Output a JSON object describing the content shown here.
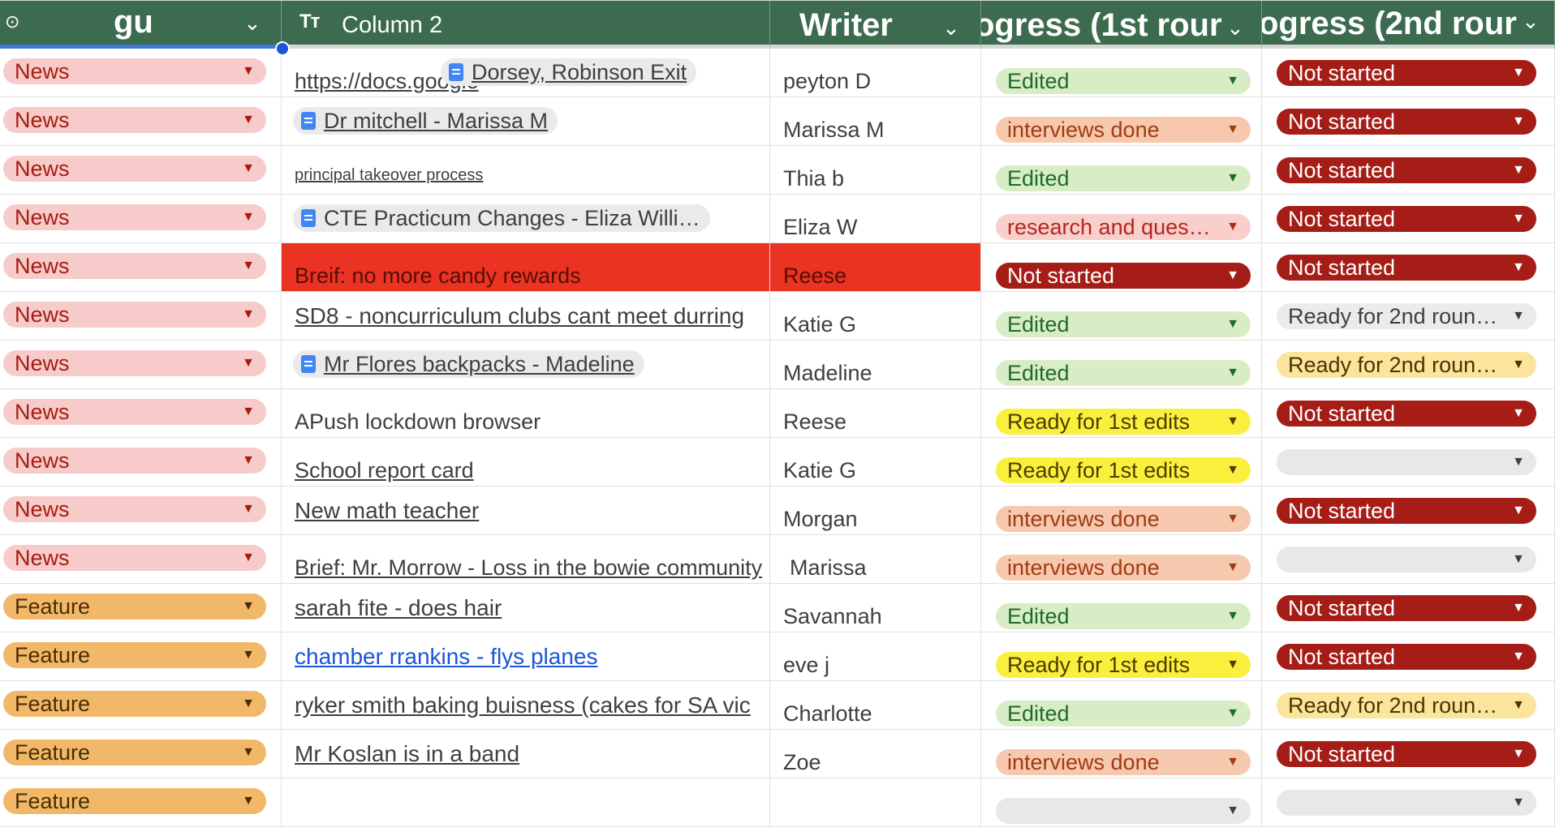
{
  "header": {
    "col1": "gu",
    "col2": "Column 2",
    "col3": "Writer",
    "col4": "ogress (1st rour",
    "col5": "ogress (2nd rour",
    "col1_icon": "chip-filter-icon",
    "col2_icon": "text-type-icon",
    "col2_icon_glyph": "Tт",
    "chevron_glyph": "⌄"
  },
  "rows": [
    {
      "category": "News",
      "title": "https://docs.google",
      "smart": "Dorsey, Robinson Exit",
      "writer": "peyton D",
      "r1": "Edited",
      "r2": "Not started"
    },
    {
      "category": "News",
      "smart": "Dr mitchell - Marissa M",
      "writer": "Marissa M",
      "r1": "interviews done",
      "r2": "Not started"
    },
    {
      "category": "News",
      "title": "principal takeover process",
      "writer": "Thia b",
      "r1": "Edited",
      "r2": "Not started"
    },
    {
      "category": "News",
      "smart": "CTE Practicum Changes - Eliza Willi…",
      "writer": "Eliza W",
      "r1": "research and ques…",
      "r2": "Not started"
    },
    {
      "category": "News",
      "title": "Breif: no more candy rewards",
      "writer": "Reese",
      "r1": "Not started",
      "r2": "Not started"
    },
    {
      "category": "News",
      "title": "SD8 - noncurriculum clubs cant meet durring",
      "writer": "Katie G",
      "r1": "Edited",
      "r2": "Ready for 2nd round ..."
    },
    {
      "category": "News",
      "smart": "Mr Flores backpacks - Madeline",
      "writer": "Madeline",
      "r1": "Edited",
      "r2": "Ready for 2nd round ..."
    },
    {
      "category": "News",
      "title": "APush lockdown browser",
      "writer": "Reese",
      "r1": "Ready for 1st edits",
      "r2": "Not started"
    },
    {
      "category": "News",
      "title": "School report card",
      "writer": "Katie G",
      "r1": "Ready for 1st edits",
      "r2": ""
    },
    {
      "category": "News",
      "title": "New math teacher",
      "writer": "Morgan",
      "r1": "interviews done",
      "r2": "Not started"
    },
    {
      "category": "News",
      "title": "Brief: Mr. Morrow - Loss in the bowie community",
      "writer": "Marissa",
      "r1": "interviews done",
      "r2": ""
    },
    {
      "category": "Feature",
      "title": "sarah fite - does hair",
      "writer": "Savannah",
      "r1": "Edited",
      "r2": "Not started"
    },
    {
      "category": "Feature",
      "title": "chamber rrankins - flys planes",
      "writer": "eve j",
      "r1": "Ready for 1st edits",
      "r2": "Not started"
    },
    {
      "category": "Feature",
      "title": "ryker smith baking buisness (cakes for SA vic",
      "writer": "Charlotte",
      "r1": "Edited",
      "r2": "Ready for 2nd roun…"
    },
    {
      "category": "Feature",
      "title": "Mr Koslan is in a band",
      "writer": "Zoe",
      "r1": "interviews done",
      "r2": "Not started"
    },
    {
      "category": "Feature",
      "title": "",
      "writer": "",
      "r1": "",
      "r2": ""
    }
  ],
  "colors": {
    "header_bg": "#3d6b4f",
    "news_chip": "#f6cbca",
    "feature_chip": "#f2b86a",
    "edited": "#d8edc6",
    "interviews_done": "#f6c8ae",
    "not_started": "#a51d16",
    "ready_1st": "#fbef3d",
    "highlight_row": "#ea3323",
    "link_blue": "#1a56d6"
  },
  "icons": {
    "dropdown": "dropdown-arrow-icon",
    "dropdown_glyph": "▼",
    "doc": "google-doc-icon"
  }
}
